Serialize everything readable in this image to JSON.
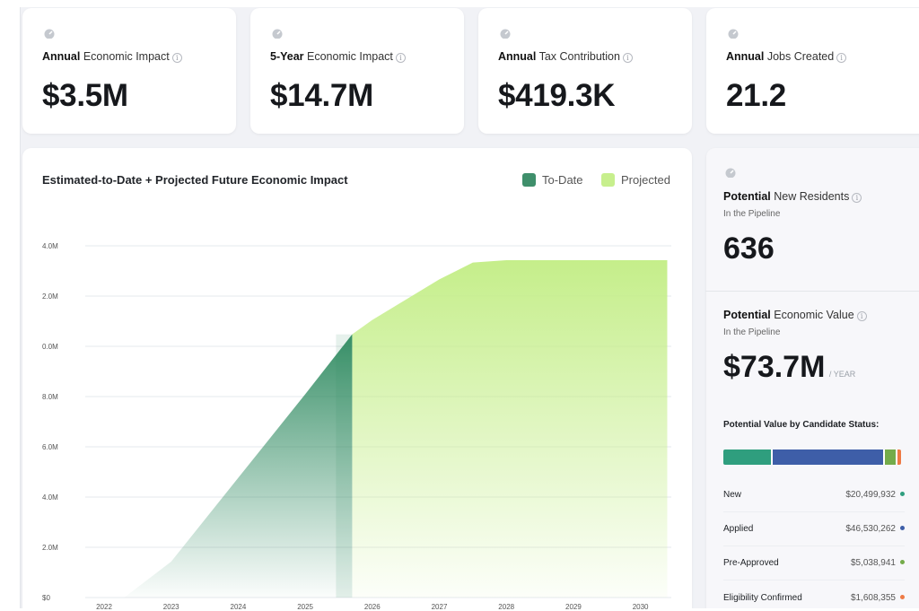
{
  "kpis": [
    {
      "bold": "Annual",
      "rest": "Economic Impact",
      "value": "$3.5M"
    },
    {
      "bold": "5-Year",
      "rest": "Economic Impact",
      "value": "$14.7M"
    },
    {
      "bold": "Annual",
      "rest": "Tax Contribution",
      "value": "$419.3K"
    },
    {
      "bold": "Annual",
      "rest": "Jobs Created",
      "value": "21.2"
    }
  ],
  "info_glyph": "i",
  "chart": {
    "title": "Estimated-to-Date + Projected Future Economic Impact",
    "legend_todate": "To-Date",
    "legend_projected": "Projected"
  },
  "chart_data": {
    "type": "area",
    "x": [
      "2022",
      "2023",
      "2024",
      "2025",
      "2026",
      "2027",
      "2028",
      "2029",
      "2030"
    ],
    "y_tick_labels": [
      "$0",
      "2.0M",
      "4.0M",
      "6.0M",
      "8.0M",
      "0.0M",
      "2.0M",
      "4.0M"
    ],
    "series": [
      {
        "name": "To-Date",
        "color": "#3f9a72",
        "points": [
          [
            2022.3,
            0
          ],
          [
            2023.0,
            1.5
          ],
          [
            2024.0,
            5.0
          ],
          [
            2025.0,
            8.5
          ],
          [
            2025.7,
            11.0
          ]
        ]
      },
      {
        "name": "Projected",
        "color": "#c7ef8d",
        "points": [
          [
            2025.7,
            11.0
          ],
          [
            2026.0,
            11.6
          ],
          [
            2027.0,
            13.3
          ],
          [
            2027.5,
            14.0
          ],
          [
            2028.0,
            14.1
          ],
          [
            2030.4,
            14.1
          ]
        ]
      }
    ],
    "ylim": [
      0,
      14.7
    ],
    "grid": true,
    "legend": "top-right"
  },
  "side": {
    "residents_bold": "Potential",
    "residents_rest": "New Residents",
    "residents_sub": "In the Pipeline",
    "residents_value": "636",
    "econ_bold": "Potential",
    "econ_rest": "Economic Value",
    "econ_sub": "In the Pipeline",
    "econ_value": "$73.7M",
    "econ_unit": "/ YEAR",
    "status_title": "Potential Value by Candidate Status:",
    "status_bar": [
      {
        "name": "New",
        "value": 20499932,
        "color": "#2f9e7e"
      },
      {
        "name": "Applied",
        "value": 46530262,
        "color": "#3e5ea8"
      },
      {
        "name": "Pre-Approved",
        "value": 5038941,
        "color": "#74ab4a"
      },
      {
        "name": "Eligibility Confirmed",
        "value": 1608355,
        "color": "#ee7a45"
      }
    ],
    "statuses": [
      {
        "name": "New",
        "value": "$20,499,932",
        "color": "#2f9e7e"
      },
      {
        "name": "Applied",
        "value": "$46,530,262",
        "color": "#3e5ea8"
      },
      {
        "name": "Pre-Approved",
        "value": "$5,038,941",
        "color": "#74ab4a"
      },
      {
        "name": "Eligibility Confirmed",
        "value": "$1,608,355",
        "color": "#ee7a45"
      }
    ]
  }
}
